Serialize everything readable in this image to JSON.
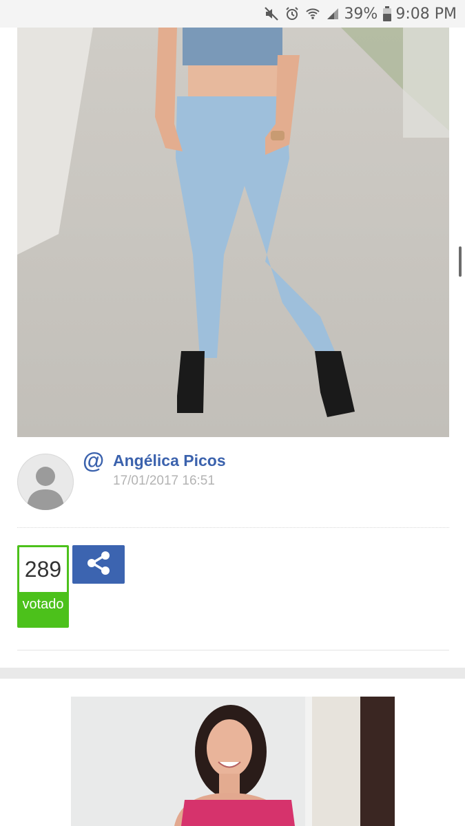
{
  "status_bar": {
    "battery_percent": "39%",
    "time": "9:08 PM",
    "icons": [
      "mute-icon",
      "alarm-icon",
      "wifi-icon",
      "signal-icon",
      "battery-icon"
    ]
  },
  "post": {
    "author_name": "Angélica Picos",
    "date": "17/01/2017 16:51",
    "vote_count": "289",
    "vote_label": "votado",
    "share_icon": "share-icon"
  },
  "colors": {
    "brand_blue": "#3b62ad",
    "vote_green": "#4cc11b",
    "date_gray": "#b3b3b3"
  }
}
